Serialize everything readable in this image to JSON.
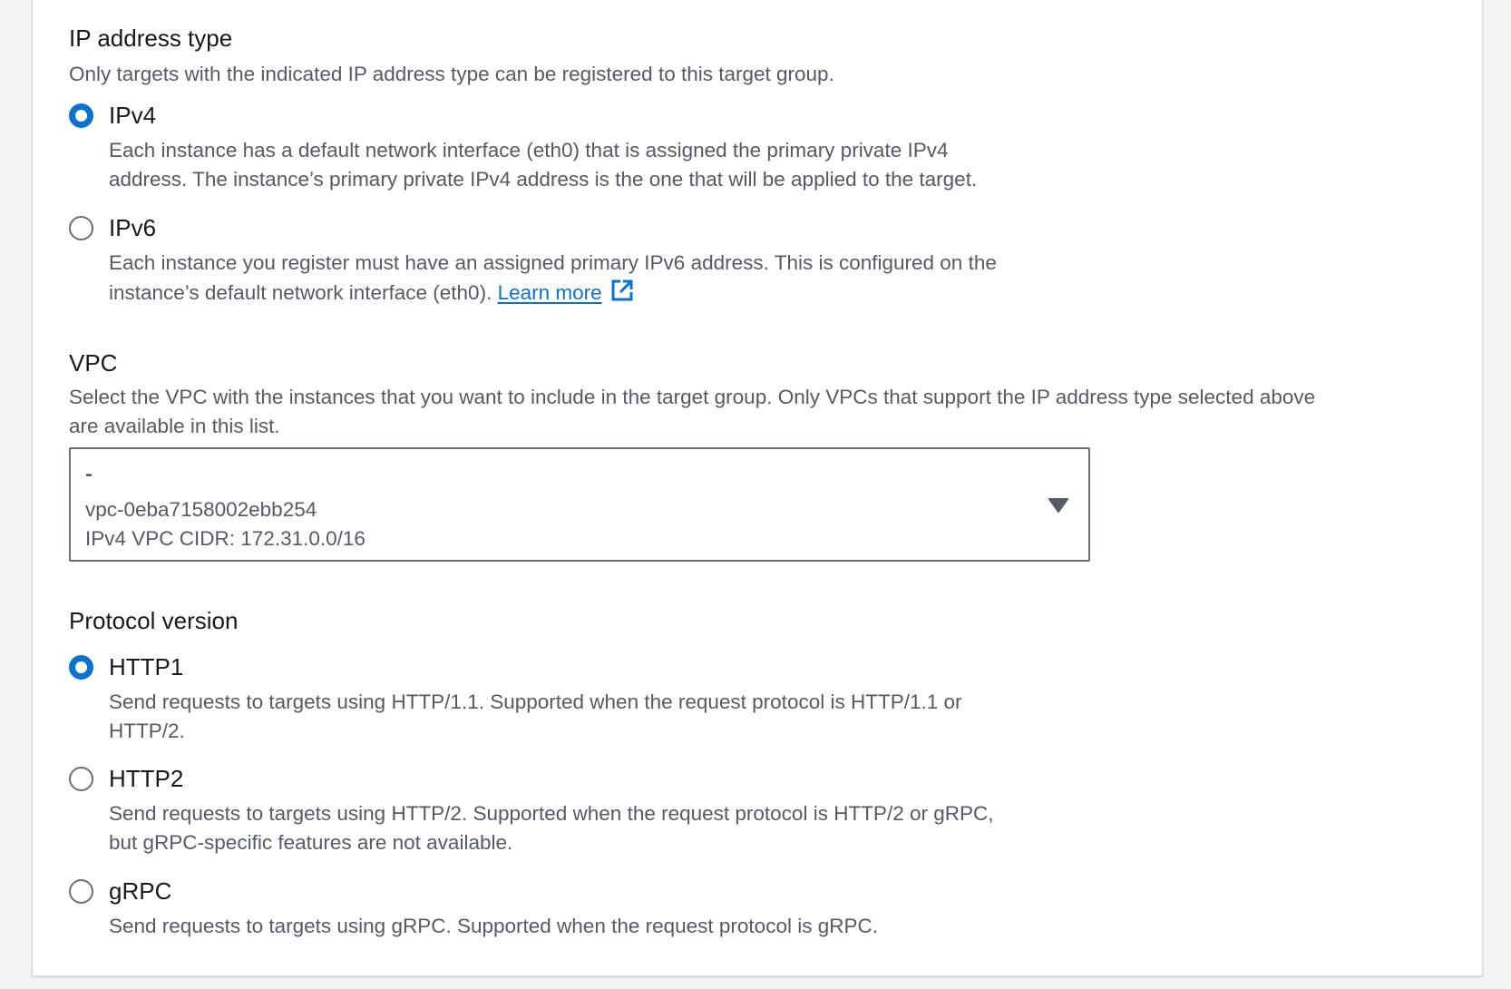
{
  "ip_address_type": {
    "label": "IP address type",
    "description": "Only targets with the indicated IP address type can be registered to this target group.",
    "options": [
      {
        "label": "IPv4",
        "checked": true,
        "description_line1": "Each instance has a default network interface (eth0) that is assigned the primary private IPv4",
        "description_line2": "address. The instance’s primary private IPv4 address is the one that will be applied to the target."
      },
      {
        "label": "IPv6",
        "checked": false,
        "description_line1": "Each instance you register must have an assigned primary IPv6 address. This is configured on the",
        "description_line2": "instance’s default network interface (eth0).",
        "link": "Learn more",
        "link_icon": "external-link-icon"
      }
    ]
  },
  "vpc": {
    "label": "VPC",
    "description_line1": "Select the VPC with the instances that you want to include in the target group. Only VPCs that support the IP address type selected above",
    "description_line2": "are available in this list.",
    "select": {
      "name": "-",
      "id": "vpc-0eba7158002ebb254",
      "cidr": "IPv4 VPC CIDR: 172.31.0.0/16",
      "icon": "caret-down-icon"
    }
  },
  "protocol_version": {
    "label": "Protocol version",
    "options": [
      {
        "label": "HTTP1",
        "checked": true,
        "description_line1": "Send requests to targets using HTTP/1.1. Supported when the request protocol is HTTP/1.1 or",
        "description_line2": "HTTP/2."
      },
      {
        "label": "HTTP2",
        "checked": false,
        "description_line1": "Send requests to targets using HTTP/2. Supported when the request protocol is HTTP/2 or gRPC,",
        "description_line2": "but gRPC-specific features are not available."
      },
      {
        "label": "gRPC",
        "checked": false,
        "description_line1": "Send requests to targets using gRPC. Supported when the request protocol is gRPC."
      }
    ]
  },
  "colors": {
    "accent": "#0972d3",
    "text": "#16191f",
    "secondary_text": "#545b64",
    "border": "#687078",
    "background": "#f2f3f3"
  }
}
